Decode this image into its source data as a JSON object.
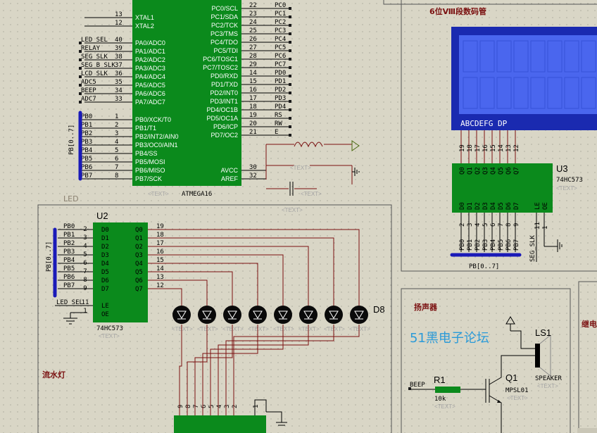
{
  "sections": {
    "led_bar": "LED",
    "seg_display": "6位Ⅷ段数码管",
    "flow_light": "流水灯",
    "speaker": "扬声器",
    "relay": "继电",
    "watermark": "51黑电子论坛"
  },
  "mcu": {
    "chip": "ATMEGA16",
    "text_tag": "<TEXT>",
    "left_pins": [
      {
        "num": "13",
        "name": "XTAL1",
        "net": ""
      },
      {
        "num": "12",
        "name": "XTAL2",
        "net": ""
      },
      {
        "num": "40",
        "name": "PA0/ADC0",
        "net": "LED_SEL"
      },
      {
        "num": "39",
        "name": "PA1/ADC1",
        "net": "RELAY"
      },
      {
        "num": "38",
        "name": "PA2/ADC2",
        "net": "SEG_SLK"
      },
      {
        "num": "37",
        "name": "PA3/ADC3",
        "net": "SEG_B_SLK"
      },
      {
        "num": "36",
        "name": "PA4/ADC4",
        "net": "LCD_SLK"
      },
      {
        "num": "35",
        "name": "PA5/ADC5",
        "net": "ADC5"
      },
      {
        "num": "34",
        "name": "PA6/ADC6",
        "net": "BEEP"
      },
      {
        "num": "33",
        "name": "PA7/ADC7",
        "net": "ADC7"
      },
      {
        "num": "1",
        "name": "PB0/XCK/T0",
        "net": "PB0"
      },
      {
        "num": "2",
        "name": "PB1/T1",
        "net": "PB1"
      },
      {
        "num": "3",
        "name": "PB2/INT2/AIN0",
        "net": "PB2"
      },
      {
        "num": "4",
        "name": "PB3/OC0/AIN1",
        "net": "PB3"
      },
      {
        "num": "5",
        "name": "PB4/SS",
        "net": "PB4"
      },
      {
        "num": "6",
        "name": "PB5/MOSI",
        "net": "PB5"
      },
      {
        "num": "7",
        "name": "PB6/MISO",
        "net": "PB6"
      },
      {
        "num": "8",
        "name": "PB7/SCK",
        "net": "PB7"
      }
    ],
    "right_pins": [
      {
        "num": "22",
        "name": "PC0/SCL",
        "net": "PC0"
      },
      {
        "num": "23",
        "name": "PC1/SDA",
        "net": "PC1"
      },
      {
        "num": "24",
        "name": "PC2/TCK",
        "net": "PC2"
      },
      {
        "num": "25",
        "name": "PC3/TMS",
        "net": "PC3"
      },
      {
        "num": "26",
        "name": "PC4/TDO",
        "net": "PC4"
      },
      {
        "num": "27",
        "name": "PC5/TDI",
        "net": "PC5"
      },
      {
        "num": "28",
        "name": "PC6/TOSC1",
        "net": "PC6"
      },
      {
        "num": "29",
        "name": "PC7/TOSC2",
        "net": "PC7"
      },
      {
        "num": "14",
        "name": "PD0/RXD",
        "net": "PD0"
      },
      {
        "num": "15",
        "name": "PD1/TXD",
        "net": "PD1"
      },
      {
        "num": "16",
        "name": "PD2/INT0",
        "net": "PD2"
      },
      {
        "num": "17",
        "name": "PD3/INT1",
        "net": "PD3"
      },
      {
        "num": "18",
        "name": "PD4/OC1B",
        "net": "PD4"
      },
      {
        "num": "19",
        "name": "PD5/OC1A",
        "net": "RS"
      },
      {
        "num": "20",
        "name": "PD6/ICP",
        "net": "RW"
      },
      {
        "num": "21",
        "name": "PD7/OC2",
        "net": "E"
      },
      {
        "num": "30",
        "name": "AVCC",
        "net": ""
      },
      {
        "num": "32",
        "name": "AREF",
        "net": ""
      }
    ],
    "bus_label": "PB[0..7]"
  },
  "u2": {
    "ref": "U2",
    "chip": "74HC573",
    "text_tag": "<TEXT>",
    "d_pins": [
      {
        "net": "PB0",
        "num": "2",
        "name": "D0"
      },
      {
        "net": "PB1",
        "num": "3",
        "name": "D1"
      },
      {
        "net": "PB2",
        "num": "4",
        "name": "D2"
      },
      {
        "net": "PB3",
        "num": "5",
        "name": "D3"
      },
      {
        "net": "PB4",
        "num": "6",
        "name": "D4"
      },
      {
        "net": "PB5",
        "num": "7",
        "name": "D5"
      },
      {
        "net": "PB6",
        "num": "8",
        "name": "D6"
      },
      {
        "net": "PB7",
        "num": "9",
        "name": "D7"
      }
    ],
    "q_pins": [
      {
        "name": "Q0",
        "num": "19"
      },
      {
        "name": "Q1",
        "num": "18"
      },
      {
        "name": "Q2",
        "num": "17"
      },
      {
        "name": "Q3",
        "num": "16"
      },
      {
        "name": "Q4",
        "num": "15"
      },
      {
        "name": "Q5",
        "num": "14"
      },
      {
        "name": "Q6",
        "num": "13"
      },
      {
        "name": "Q7",
        "num": "12"
      }
    ],
    "le": {
      "net": "LED_SEL",
      "num": "11",
      "name": "LE"
    },
    "oe": {
      "num": "1",
      "name": "OE"
    },
    "bus_label": "PB[0..7]",
    "led_ref": "D8",
    "led_tag": "<TEXT>",
    "resnet_pins": [
      "9",
      "8",
      "7",
      "6",
      "5",
      "4",
      "3",
      "2",
      "1"
    ]
  },
  "u3": {
    "ref": "U3",
    "chip": "74HC573",
    "text_tag": "<TEXT>",
    "seg_letters": "ABCDEFG DP",
    "top_nums": [
      "19",
      "18",
      "17",
      "16",
      "15",
      "14",
      "13",
      "12"
    ],
    "q_names": [
      "Q0",
      "Q1",
      "Q2",
      "Q3",
      "Q4",
      "Q5",
      "Q6",
      "Q7"
    ],
    "d_names": [
      "D0",
      "D1",
      "D2",
      "D3",
      "D4",
      "D5",
      "D6",
      "D7"
    ],
    "bottom_nums": [
      "2",
      "3",
      "4",
      "5",
      "6",
      "7",
      "8",
      "9"
    ],
    "bottom_nets": [
      "PB0",
      "PB1",
      "PB2",
      "PB3",
      "PB4",
      "PB5",
      "PB6",
      "PB7"
    ],
    "le_name": "LE",
    "oe_name": "OE",
    "le_num": "11",
    "oe_num": "1",
    "le_net": "SEG_SLK",
    "bus_label": "PB[0..7]"
  },
  "osc": {
    "tag1": "<TEXT>",
    "tag2": "<TEXT>",
    "tag3": "<TEXT>"
  },
  "speaker": {
    "r_ref": "R1",
    "r_val": "10k",
    "r_tag": "<TEXT>",
    "q_ref": "Q1",
    "q_part": "MPSL01",
    "q_tag": "<TEXT>",
    "ls_ref": "LS1",
    "ls_part": "SPEAKER",
    "ls_tag": "<TEXT>",
    "net": "BEEP"
  },
  "colors": {
    "background": "#d9d6c6",
    "chip": "#0b8a1c",
    "wire": "#7a1010",
    "bus": "#1a1ab8",
    "lcd_frame": "#1a2ab0",
    "lcd_screen": "#4a66ee",
    "grid_dot": "#8a8a80"
  }
}
